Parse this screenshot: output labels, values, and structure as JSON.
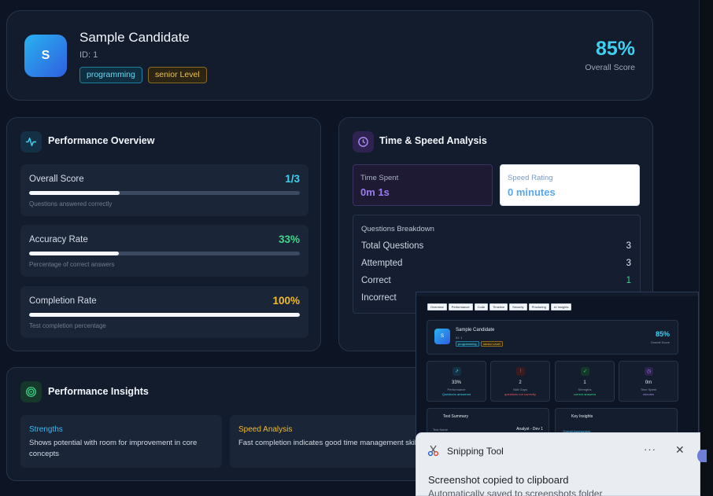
{
  "candidate": {
    "avatar_letter": "S",
    "name": "Sample Candidate",
    "id": "ID: 1",
    "tags": [
      "programming",
      "senior Level"
    ],
    "overall_score": "85%",
    "overall_score_label": "Overall Score"
  },
  "performance": {
    "title": "Performance Overview",
    "metrics": [
      {
        "label": "Overall Score",
        "value": "1/3",
        "hint": "Questions answered correctly",
        "fraction": 0.333,
        "color": "#3fd0f0"
      },
      {
        "label": "Accuracy Rate",
        "value": "33%",
        "hint": "Percentage of correct answers",
        "fraction": 0.33,
        "color": "#3fd68a"
      },
      {
        "label": "Completion Rate",
        "value": "100%",
        "hint": "Test completion percentage",
        "fraction": 1.0,
        "color": "#f3b928"
      }
    ]
  },
  "time": {
    "title": "Time & Speed Analysis",
    "spent_label": "Time Spent",
    "spent_value": "0m 1s",
    "rating_label": "Speed Rating",
    "rating_value": "0 minutes",
    "breakdown_title": "Questions Breakdown",
    "rows": [
      {
        "label": "Total Questions",
        "value": "3"
      },
      {
        "label": "Attempted",
        "value": "3"
      },
      {
        "label": "Correct",
        "value": "1"
      },
      {
        "label": "Incorrect",
        "value": ""
      }
    ]
  },
  "insights": {
    "title": "Performance Insights",
    "cards": [
      {
        "title": "Strengths",
        "body": "Shows potential with room for improvement in core concepts",
        "color": "#3fb7f0"
      },
      {
        "title": "Speed Analysis",
        "body": "Fast completion indicates good time management skills",
        "color": "#f3b928"
      }
    ]
  },
  "preview": {
    "tabs": [
      "Overview",
      "Performance",
      "Code",
      "Timeline",
      "Security",
      "Proctoring",
      "AI Insights"
    ],
    "name": "Sample Candidate",
    "id": "ID: 1",
    "tags": [
      "programming",
      "senior Level"
    ],
    "score": "85%",
    "score_label": "Overall Score",
    "stats": [
      {
        "value": "33%",
        "label": "Performance",
        "sub": "Questions answered"
      },
      {
        "value": "2",
        "label": "Skill Gaps",
        "sub": "questions not correctly"
      },
      {
        "value": "1",
        "label": "Strengths",
        "sub": "correct answers"
      },
      {
        "value": "0m",
        "label": "Time Spent",
        "sub": "minutes"
      }
    ],
    "test_summary": "Test Summary",
    "test_name_label": "Test Name",
    "test_name_value": "Analyst - Dev 1",
    "key_insights": "Key Insights",
    "key_insight_item": "Overall Assessment"
  },
  "toast": {
    "app": "Snipping Tool",
    "more": "···",
    "close": "✕",
    "message": "Screenshot copied to clipboard",
    "sub": "Automatically saved to screenshots folder"
  }
}
